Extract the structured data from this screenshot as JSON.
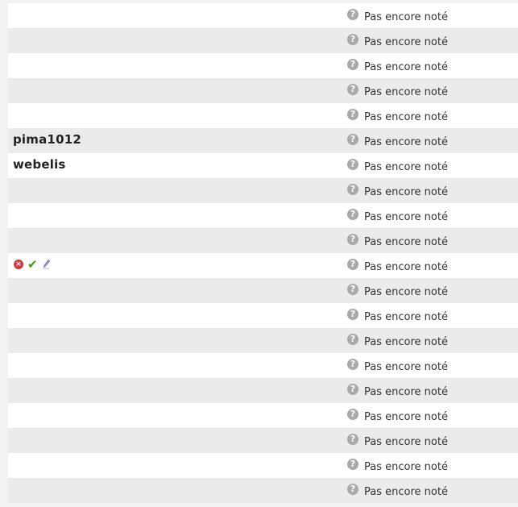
{
  "rows": [
    {
      "name": "",
      "status": "Pas encore noté"
    },
    {
      "name": "",
      "status": "Pas encore noté"
    },
    {
      "name": "",
      "status": "Pas encore noté"
    },
    {
      "name": "",
      "status": "Pas encore noté"
    },
    {
      "name": "",
      "status": "Pas encore noté"
    },
    {
      "name": "pima1012",
      "status": "Pas encore noté"
    },
    {
      "name": "webelis",
      "status": "Pas encore noté"
    },
    {
      "name": "",
      "status": "Pas encore noté"
    },
    {
      "name": "",
      "status": "Pas encore noté"
    },
    {
      "name": "",
      "status": "Pas encore noté"
    },
    {
      "name": "",
      "status": "Pas encore noté",
      "actions": [
        "delete-icon",
        "approve-icon",
        "edit-icon"
      ]
    },
    {
      "name": "",
      "status": "Pas encore noté"
    },
    {
      "name": "",
      "status": "Pas encore noté"
    },
    {
      "name": "",
      "status": "Pas encore noté"
    },
    {
      "name": "",
      "status": "Pas encore noté"
    },
    {
      "name": "",
      "status": "Pas encore noté"
    },
    {
      "name": "",
      "status": "Pas encore noté"
    },
    {
      "name": "",
      "status": "Pas encore noté"
    },
    {
      "name": "",
      "status": "Pas encore noté"
    },
    {
      "name": "",
      "status": "Pas encore noté"
    }
  ],
  "icons": {
    "status_icon": "question-icon",
    "delete_color": "#d23a3a",
    "approve_color": "#3f9a1a"
  }
}
